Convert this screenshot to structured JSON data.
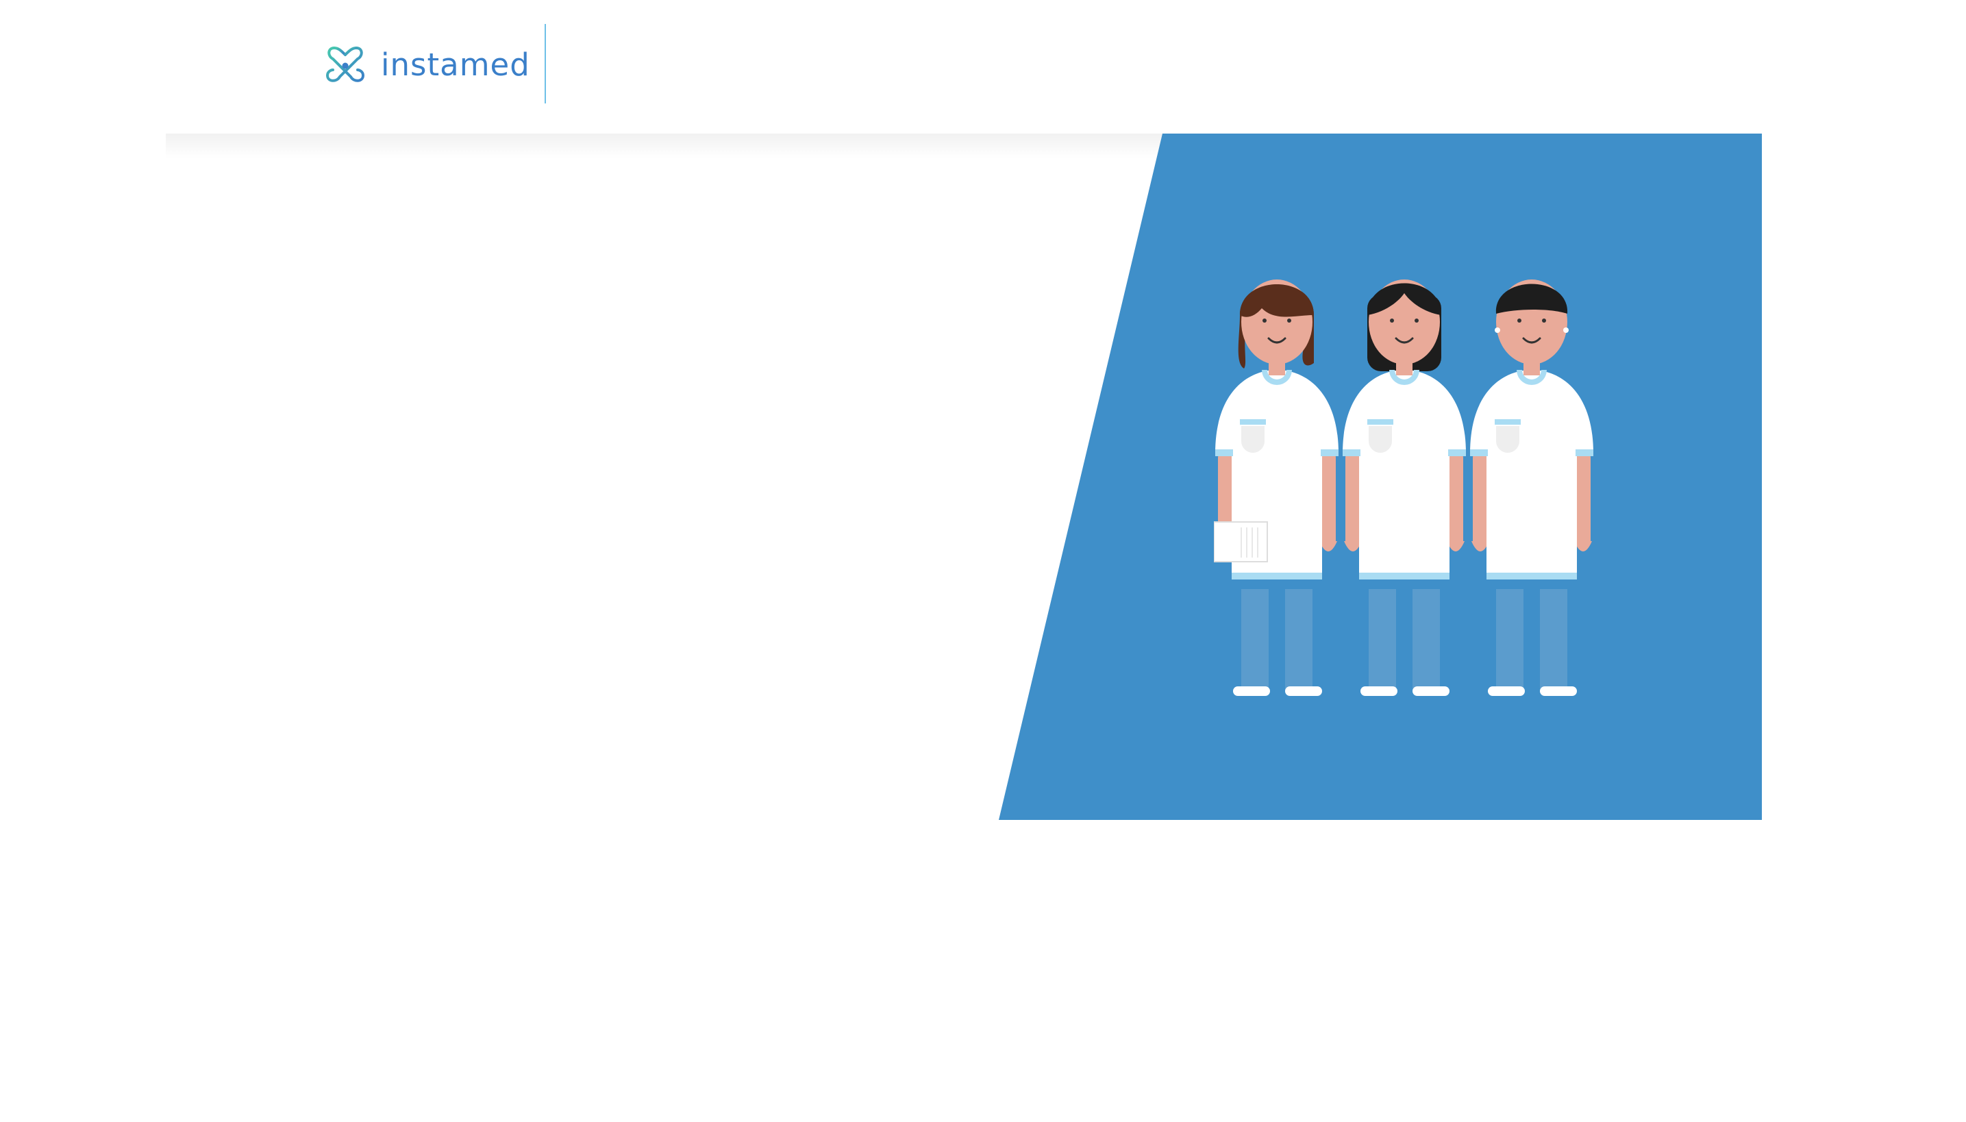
{
  "header": {
    "logo": {
      "icon": "instamed-logo-icon",
      "text": "instamed",
      "color": "#3a7fc9",
      "accent": "#45c4b0"
    },
    "divider_color": "#6ec0e8"
  },
  "hero": {
    "panel_color": "#3f8fc9",
    "illustration": {
      "icon": "three-nurses-illustration",
      "figures": [
        "nurse-brown-hair-with-clipboard",
        "nurse-black-long-hair",
        "nurse-black-short-hair"
      ],
      "uniform_color": "#ffffff",
      "trim_color": "#a9dcf3",
      "skin_color": "#e9aa99"
    }
  }
}
